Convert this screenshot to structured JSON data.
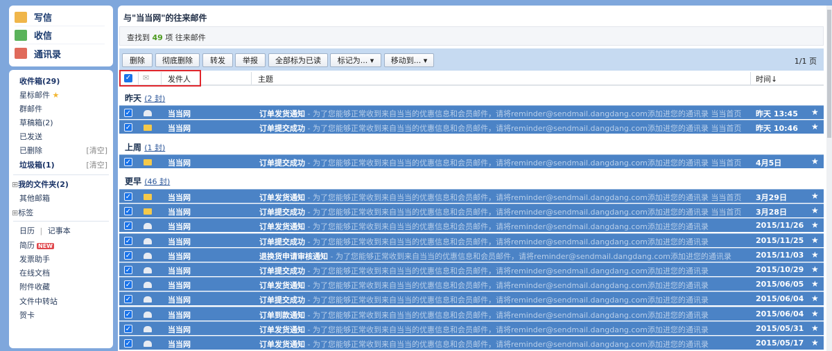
{
  "quick": [
    {
      "label": "写信",
      "icon": "compose-icon",
      "color": "#e8a23a"
    },
    {
      "label": "收信",
      "icon": "inbox-download-icon",
      "color": "#3a9c3a"
    },
    {
      "label": "通讯录",
      "icon": "contacts-icon",
      "color": "#d9534f"
    }
  ],
  "nav": {
    "inbox": "收件箱(29)",
    "starred": "星标邮件",
    "group": "群邮件",
    "drafts": "草稿箱(2)",
    "sent": "已发送",
    "deleted": "已删除",
    "spam": "垃圾箱(1)",
    "clear": "[清空]",
    "myfolders": "我的文件夹(2)",
    "other": "其他邮箱",
    "tags": "标签",
    "calendar": "日历",
    "notes": "记事本",
    "divider": "|",
    "resume": "简历",
    "new_badge": "NEW",
    "invoice": "发票助手",
    "docs": "在线文档",
    "attach": "附件收藏",
    "transfer": "文件中转站",
    "cards": "贺卡",
    "expand": "⊞"
  },
  "main": {
    "title": "与\"当当网\"的往来邮件",
    "found_prefix": "查找到",
    "found_count": "49",
    "found_suffix": "项 往来邮件",
    "pager": "1/1 页"
  },
  "toolbar": [
    "删除",
    "彻底删除",
    "转发",
    "举报",
    "全部标为已读",
    "标记为... ▾",
    "移动到... ▾"
  ],
  "columns": {
    "sender": "发件人",
    "subject": "主题",
    "time": "时间↓"
  },
  "groups": [
    {
      "label": "昨天",
      "count": "(2 封)"
    },
    {
      "label": "上周",
      "count": "(1 封)"
    },
    {
      "label": "更早",
      "count": "(46 封)"
    }
  ],
  "preview_long": " - 为了您能够正常收到来自当当的优惠信息和会员邮件，请将reminder@sendmail.dangdang.com添加进您的通讯录  当当首页｜...",
  "preview_short": " - 为了您能够正常收到来自当当的优惠信息和会员邮件，请将reminder@sendmail.dangdang.com添加进您的通讯录",
  "rows": [
    {
      "sender": "当当网",
      "subject": "订单发货通知",
      "long": true,
      "time": "昨天 13:45",
      "read": true
    },
    {
      "sender": "当当网",
      "subject": "订单提交成功",
      "long": true,
      "time": "昨天 10:46",
      "read": false
    },
    {
      "sender": "当当网",
      "subject": "订单提交成功",
      "long": true,
      "time": "4月5日",
      "read": false
    },
    {
      "sender": "当当网",
      "subject": "订单发货通知",
      "long": true,
      "time": "3月29日",
      "read": false
    },
    {
      "sender": "当当网",
      "subject": "订单提交成功",
      "long": true,
      "time": "3月28日",
      "read": false
    },
    {
      "sender": "当当网",
      "subject": "订单发货通知",
      "long": false,
      "time": "2015/11/26",
      "read": true
    },
    {
      "sender": "当当网",
      "subject": "订单提交成功",
      "long": false,
      "time": "2015/11/25",
      "read": true
    },
    {
      "sender": "当当网",
      "subject": "退换货申请审核通知",
      "long": false,
      "time": "2015/11/03",
      "read": true
    },
    {
      "sender": "当当网",
      "subject": "订单提交成功",
      "long": false,
      "time": "2015/10/29",
      "read": true
    },
    {
      "sender": "当当网",
      "subject": "订单发货通知",
      "long": false,
      "time": "2015/06/05",
      "read": true
    },
    {
      "sender": "当当网",
      "subject": "订单提交成功",
      "long": false,
      "time": "2015/06/04",
      "read": true
    },
    {
      "sender": "当当网",
      "subject": "订单到款通知",
      "long": false,
      "time": "2015/06/04",
      "read": true
    },
    {
      "sender": "当当网",
      "subject": "订单发货通知",
      "long": false,
      "time": "2015/05/31",
      "read": true
    },
    {
      "sender": "当当网",
      "subject": "订单发货通知",
      "long": false,
      "time": "2015/05/17",
      "read": true
    }
  ],
  "star": "★",
  "check": "✓"
}
